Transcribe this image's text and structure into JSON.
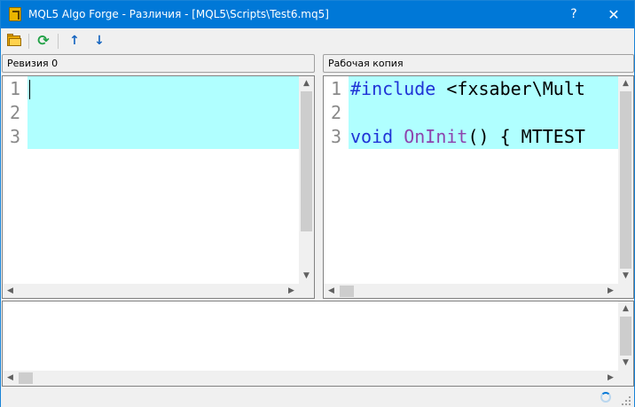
{
  "window": {
    "title": "MQL5 Algo Forge - Различия - [MQL5\\Scripts\\Test6.mq5]",
    "help_label": "?",
    "close_label": "✕"
  },
  "toolbar": {
    "open_icon": "folder-icon",
    "refresh_icon": "refresh-icon",
    "refresh_glyph": "⟳",
    "prev_icon": "arrow-up-icon",
    "prev_glyph": "↑",
    "next_icon": "arrow-down-icon",
    "next_glyph": "↓"
  },
  "left_pane": {
    "header": "Ревизия 0",
    "line_numbers": [
      "1",
      "2",
      "3"
    ],
    "lines": [
      "",
      "",
      ""
    ]
  },
  "right_pane": {
    "header": "Рабочая копия",
    "line_numbers": [
      "1",
      "2",
      "3"
    ],
    "line1_directive": "#include",
    "line1_rest": " <fxsaber\\Mult",
    "line3_type": "void",
    "line3_func": "OnInit",
    "line3_rest": "() { MTTEST"
  },
  "scrollbar": {
    "up": "▲",
    "down": "▼",
    "left": "◀",
    "right": "▶"
  },
  "colors": {
    "titlebar": "#0078d7",
    "diff_highlight": "#b0ffff",
    "keyword": "#1f33d6",
    "function": "#8e44ad"
  }
}
